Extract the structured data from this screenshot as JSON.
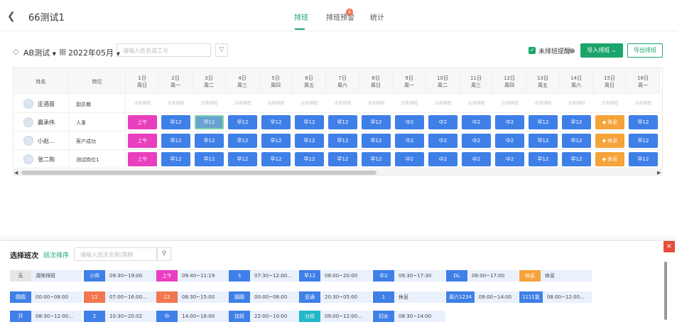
{
  "header": {
    "title": "66测试1",
    "tabs": [
      "排班",
      "排班预警",
      "统计"
    ],
    "badge": "4"
  },
  "toolbar": {
    "group": "AB测试",
    "month": "2022年05月",
    "search_placeholder": "请输入姓名或工号",
    "unscheduled_label": "未排班提醒",
    "import_label": "导入排班",
    "export_label": "导出排班"
  },
  "table": {
    "col_name": "姓名",
    "col_position": "岗位",
    "days": [
      {
        "d": "1日",
        "w": "周日"
      },
      {
        "d": "2日",
        "w": "周一"
      },
      {
        "d": "3日",
        "w": "周二"
      },
      {
        "d": "4日",
        "w": "周三"
      },
      {
        "d": "5日",
        "w": "周四"
      },
      {
        "d": "6日",
        "w": "周五"
      },
      {
        "d": "7日",
        "w": "周六"
      },
      {
        "d": "8日",
        "w": "周日"
      },
      {
        "d": "9日",
        "w": "周一"
      },
      {
        "d": "10日",
        "w": "周二"
      },
      {
        "d": "11日",
        "w": "周三"
      },
      {
        "d": "12日",
        "w": "周四"
      },
      {
        "d": "13日",
        "w": "周五"
      },
      {
        "d": "14日",
        "w": "周六"
      },
      {
        "d": "15日",
        "w": "周日"
      },
      {
        "d": "16日",
        "w": "周一"
      }
    ],
    "rows": [
      {
        "name": "庄酒苗",
        "position": "副总裁",
        "cells": [
          "点击排班",
          "点击排班",
          "点击排班",
          "点击排班",
          "点击排班",
          "点击排班",
          "点击排班",
          "点击排班",
          "点击排班",
          "点击排班",
          "点击排班",
          "点击排班",
          "点击排班",
          "点击排班",
          "点击排班",
          "点击排班"
        ]
      },
      {
        "name": "晨承伟",
        "position": "人事",
        "cells": [
          "上午",
          "早12",
          "早12",
          "早12",
          "早12",
          "早12",
          "早12",
          "早12",
          "中2",
          "中2",
          "中2",
          "中2",
          "早12",
          "早12",
          "休息",
          "早12"
        ]
      },
      {
        "name": "小赵...",
        "position": "客户成功",
        "cells": [
          "上午",
          "早12",
          "早12",
          "早12",
          "早12",
          "早12",
          "早12",
          "早12",
          "中2",
          "中2",
          "中2",
          "中2",
          "早12",
          "早12",
          "休息",
          "早12"
        ]
      },
      {
        "name": "张二狗",
        "position": "测试岗位1",
        "cells": [
          "上午",
          "早12",
          "早12",
          "早12",
          "早12",
          "早12",
          "早12",
          "早12",
          "中2",
          "中2",
          "中2",
          "中2",
          "早12",
          "早12",
          "休息",
          "早12"
        ]
      }
    ]
  },
  "panel": {
    "title": "选择班次",
    "sort_label": "班次排序",
    "search_placeholder": "请输入班次名称/简称",
    "close": "×",
    "shifts": [
      {
        "tag": "无",
        "time": "清除排班",
        "color": "#e6e6e6",
        "fg": "#555"
      },
      {
        "tag": "小师",
        "time": "09:30~19:00",
        "color": "#3f7fe8",
        "fg": "#fff"
      },
      {
        "tag": "上午",
        "time": "09:40~11:19",
        "color": "#e83fbf",
        "fg": "#fff"
      },
      {
        "tag": "3",
        "time": "07:30~12:00...",
        "color": "#3f7fe8",
        "fg": "#fff"
      },
      {
        "tag": "早12",
        "time": "08:00~20:00",
        "color": "#3f7fe8",
        "fg": "#fff"
      },
      {
        "tag": "中2",
        "time": "09:30~17:30",
        "color": "#3f7fe8",
        "fg": "#fff"
      },
      {
        "tag": "DL",
        "time": "08:00~17:00",
        "color": "#3f7fe8",
        "fg": "#fff"
      },
      {
        "tag": "休息",
        "time": "休息",
        "color": "#f5a33a",
        "fg": "#fff"
      },
      {
        "tag": "圆圆",
        "time": "00:00~08:00",
        "color": "#3f7fe8",
        "fg": "#fff"
      },
      {
        "tag": "11",
        "time": "07:00~16:00...",
        "color": "#f2764f",
        "fg": "#fff"
      },
      {
        "tag": "12",
        "time": "08:30~15:00",
        "color": "#f2764f",
        "fg": "#fff"
      },
      {
        "tag": "圆圆",
        "time": "00:00~08:00",
        "color": "#3f7fe8",
        "fg": "#fff"
      },
      {
        "tag": "亚通",
        "time": "20:30~05:00",
        "color": "#3f7fe8",
        "fg": "#fff"
      },
      {
        "tag": "1",
        "time": "休息",
        "color": "#3f7fe8",
        "fg": "#fff"
      },
      {
        "tag": "周六1234",
        "time": "09:00~14:00",
        "color": "#3f7fe8",
        "fg": "#fff"
      },
      {
        "tag": "1111复",
        "time": "08:00~12:00...",
        "color": "#3f7fe8",
        "fg": "#fff"
      },
      {
        "tag": "开",
        "time": "08:30~12:00...",
        "color": "#3f7fe8",
        "fg": "#fff"
      },
      {
        "tag": "2",
        "time": "10:30~20:02",
        "color": "#3f7fe8",
        "fg": "#fff"
      },
      {
        "tag": "中",
        "time": "14:00~18:00",
        "color": "#3f7fe8",
        "fg": "#fff"
      },
      {
        "tag": "加班",
        "time": "22:00~10:00",
        "color": "#3f7fe8",
        "fg": "#fff"
      },
      {
        "tag": "分段",
        "time": "09:00~12:00...",
        "color": "#22b8c9",
        "fg": "#fff"
      },
      {
        "tag": "妇女",
        "time": "08:30~14:00",
        "color": "#3f7fe8",
        "fg": "#fff"
      }
    ]
  }
}
